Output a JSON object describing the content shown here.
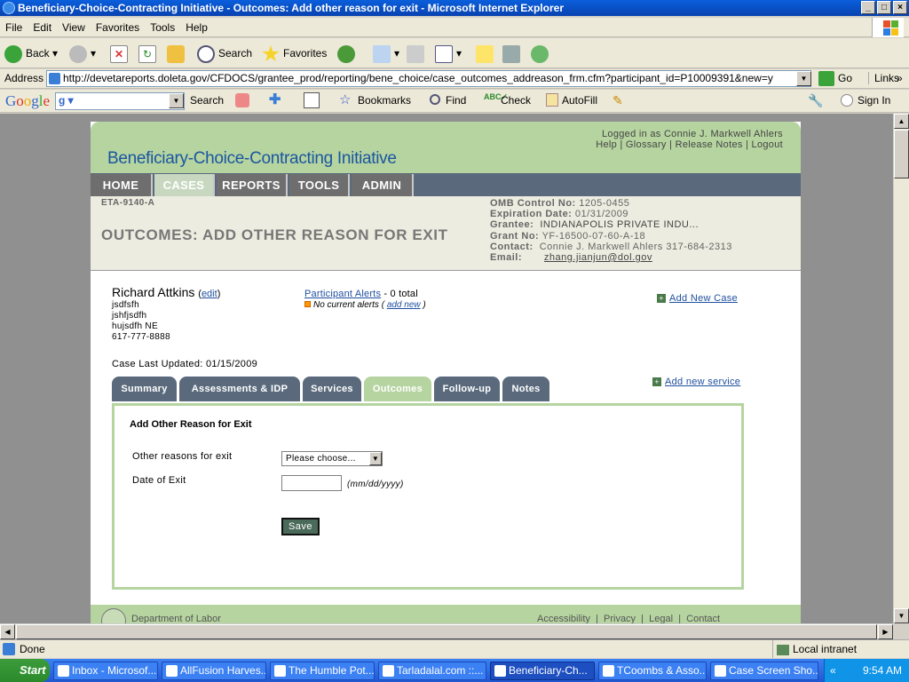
{
  "window": {
    "title": "Beneficiary-Choice-Contracting Initiative - Outcomes: Add other reason for exit - Microsoft Internet Explorer"
  },
  "menu": [
    "File",
    "Edit",
    "View",
    "Favorites",
    "Tools",
    "Help"
  ],
  "toolbar": {
    "back": "Back",
    "search": "Search",
    "favorites": "Favorites"
  },
  "address": {
    "label": "Address",
    "url": "http://devetareports.doleta.gov/CFDOCS/grantee_prod/reporting/bene_choice/case_outcomes_addreason_frm.cfm?participant_id=P10009391&new=y",
    "go": "Go",
    "links": "Links"
  },
  "google": {
    "search": "Search",
    "bookmarks": "Bookmarks",
    "find": "Find",
    "check": "Check",
    "autofill": "AutoFill",
    "signin": "Sign In"
  },
  "page": {
    "logged_in": "Logged in as Connie J. Markwell Ahlers",
    "links": [
      "Help",
      "Glossary",
      "Release Notes",
      "Logout"
    ],
    "site_title": "Beneficiary-Choice-Contracting Initiative",
    "nav": [
      "HOME",
      "CASES",
      "REPORTS",
      "TOOLS",
      "ADMIN"
    ],
    "form_id": "ETA-9140-A",
    "title": "OUTCOMES: ADD OTHER REASON FOR EXIT",
    "info": {
      "omb_label": "OMB Control No:",
      "omb": "1205-0455",
      "exp_label": "Expiration Date:",
      "exp": "01/31/2009",
      "grantee_label": "Grantee:",
      "grantee": "INDIANAPOLIS PRIVATE INDU...",
      "grant_label": "Grant No:",
      "grant": "YF-16500-07-60-A-18",
      "contact_label": "Contact:",
      "contact": "Connie J. Markwell Ahlers  317-684-2313",
      "email_label": "Email:",
      "email": "zhang.jianjun@dol.gov"
    },
    "participant": {
      "name": "Richard Attkins",
      "edit": "edit",
      "addr1": "jsdfsfh",
      "addr2": "jshfjsdfh",
      "addr3": "hujsdfh NE",
      "phone": "617-777-8888"
    },
    "alerts": {
      "label": "Participant Alerts",
      "total": "- 0 total",
      "none": "No current alerts (",
      "add": "add new",
      "close": ")"
    },
    "add_case": "Add New Case",
    "updated": "Case Last Updated: 01/15/2009",
    "tabs": [
      "Summary",
      "Assessments & IDP",
      "Services",
      "Outcomes",
      "Follow-up",
      "Notes"
    ],
    "add_service": "Add new service",
    "form": {
      "heading": "Add Other Reason for Exit",
      "reason_label": "Other reasons for exit",
      "reason_value": "Please choose...",
      "date_label": "Date of Exit",
      "date_value": "",
      "date_hint": "(mm/dd/yyyy)",
      "save": "Save"
    },
    "footer": {
      "dept": "Department of Labor",
      "links": [
        "Accessibility",
        "Privacy",
        "Legal",
        "Contact"
      ]
    }
  },
  "status": {
    "text": "Done",
    "zone": "Local intranet"
  },
  "taskbar": {
    "start": "Start",
    "tasks": [
      "Inbox - Microsof...",
      "AllFusion Harves...",
      "The Humble Pot...",
      "Tarladalal.com ::...",
      "Beneficiary-Ch...",
      "TCoombs & Asso...",
      "Case Screen Sho..."
    ],
    "time": "9:54 AM"
  }
}
